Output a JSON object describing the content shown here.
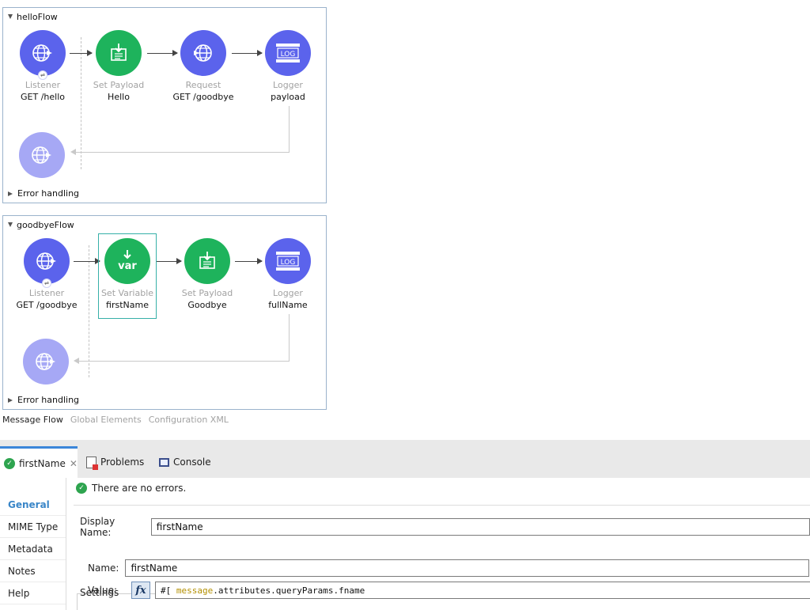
{
  "flows": [
    {
      "title": "helloFlow",
      "nodes": [
        {
          "type": "Listener",
          "name": "GET /hello",
          "icon": "globe-icon",
          "color": "#5b63ec"
        },
        {
          "type": "Set Payload",
          "name": "Hello",
          "icon": "set-payload-icon",
          "color": "#1eb35c"
        },
        {
          "type": "Request",
          "name": "GET /goodbye",
          "icon": "globe-icon",
          "color": "#5b63ec"
        },
        {
          "type": "Logger",
          "name": "payload",
          "icon": "logger-icon",
          "color": "#5b63ec"
        }
      ],
      "error_handling": "Error handling"
    },
    {
      "title": "goodbyeFlow",
      "nodes": [
        {
          "type": "Listener",
          "name": "GET /goodbye",
          "icon": "globe-icon",
          "color": "#5b63ec"
        },
        {
          "type": "Set Variable",
          "name": "firstName",
          "icon": "set-variable-icon",
          "color": "#1eb35c",
          "icon_text": "var"
        },
        {
          "type": "Set Payload",
          "name": "Goodbye",
          "icon": "set-payload-icon",
          "color": "#1eb35c"
        },
        {
          "type": "Logger",
          "name": "fullName",
          "icon": "logger-icon",
          "color": "#5b63ec"
        }
      ],
      "error_handling": "Error handling"
    }
  ],
  "logger_icon_text": "LOG",
  "editor_tabs": [
    "Message Flow",
    "Global Elements",
    "Configuration XML"
  ],
  "panel": {
    "tabs": [
      {
        "label": "firstName",
        "icon": "check-circle-icon"
      },
      {
        "label": "Problems",
        "icon": "problems-icon"
      },
      {
        "label": "Console",
        "icon": "console-icon"
      }
    ],
    "sidebar": [
      "General",
      "MIME Type",
      "Metadata",
      "Notes",
      "Help"
    ],
    "status": "There are no errors.",
    "display_name_label": "Display Name:",
    "display_name_value": "firstName",
    "settings_label": "Settings",
    "name_label": "Name:",
    "name_value": "firstName",
    "value_label": "Value:",
    "fx_label": "fx",
    "value_prefix": "#[ ",
    "value_keyword": "message",
    "value_rest": ".attributes.queryParams.fname"
  },
  "colors": {
    "accent": "#3c86d9",
    "selection": "#36b0a8",
    "connector_green": "#1eb35c",
    "connector_blue": "#5b63ec"
  }
}
